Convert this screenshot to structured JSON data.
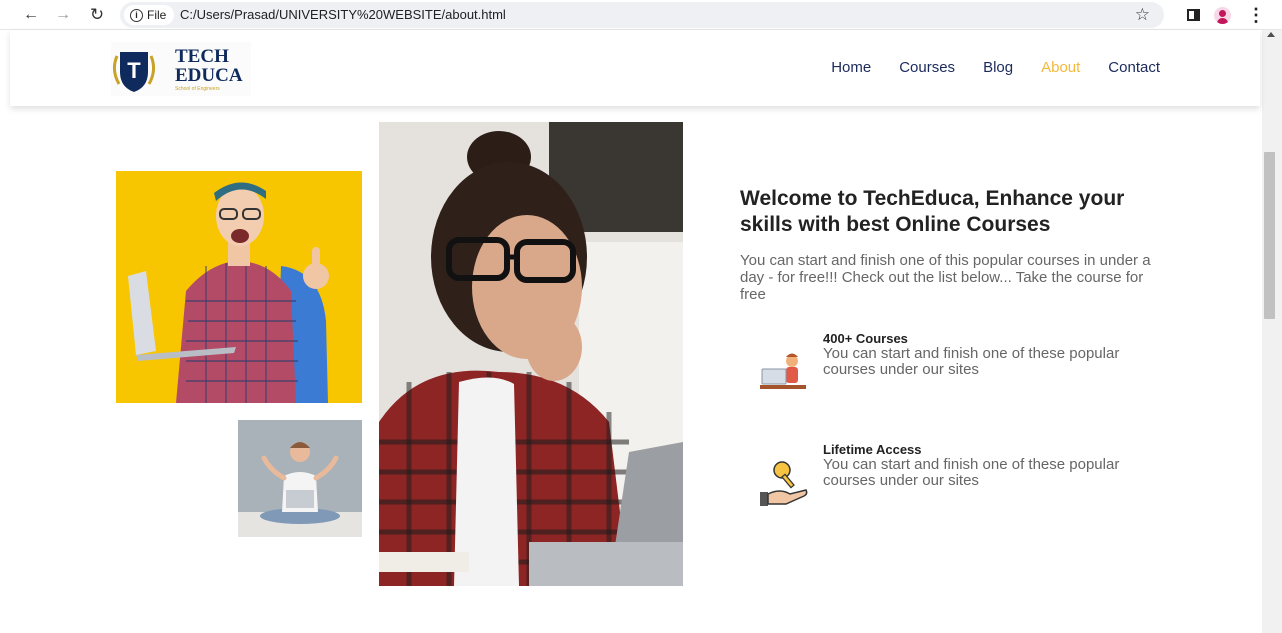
{
  "browser": {
    "chip_label": "File",
    "url": "C:/Users/Prasad/UNIVERSITY%20WEBSITE/about.html"
  },
  "logo": {
    "line1": "TECH",
    "line2": "EDUCA",
    "tagline": "School of Engineers",
    "badge_letter": "T"
  },
  "nav": [
    {
      "label": "Home",
      "active": false
    },
    {
      "label": "Courses",
      "active": false
    },
    {
      "label": "Blog",
      "active": false
    },
    {
      "label": "About",
      "active": true
    },
    {
      "label": "Contact",
      "active": false
    }
  ],
  "colors": {
    "nav_active": "#f6b93b",
    "nav_default": "#1b2a5c",
    "heading": "#222222",
    "body_text": "#666666"
  },
  "about": {
    "heading": "Welcome to TechEduca, Enhance your skills with best Online Courses",
    "intro": "You can start and finish one of this popular courses in under a day - for free!!! Check out the list below... Take the course for free"
  },
  "features": [
    {
      "title": "400+ Courses",
      "description": "You can start and finish one of these popular courses under our sites",
      "icon": "student-laptop-icon"
    },
    {
      "title": "Lifetime Access",
      "description": "You can start and finish one of these popular courses under our sites",
      "icon": "key-hand-icon"
    }
  ]
}
